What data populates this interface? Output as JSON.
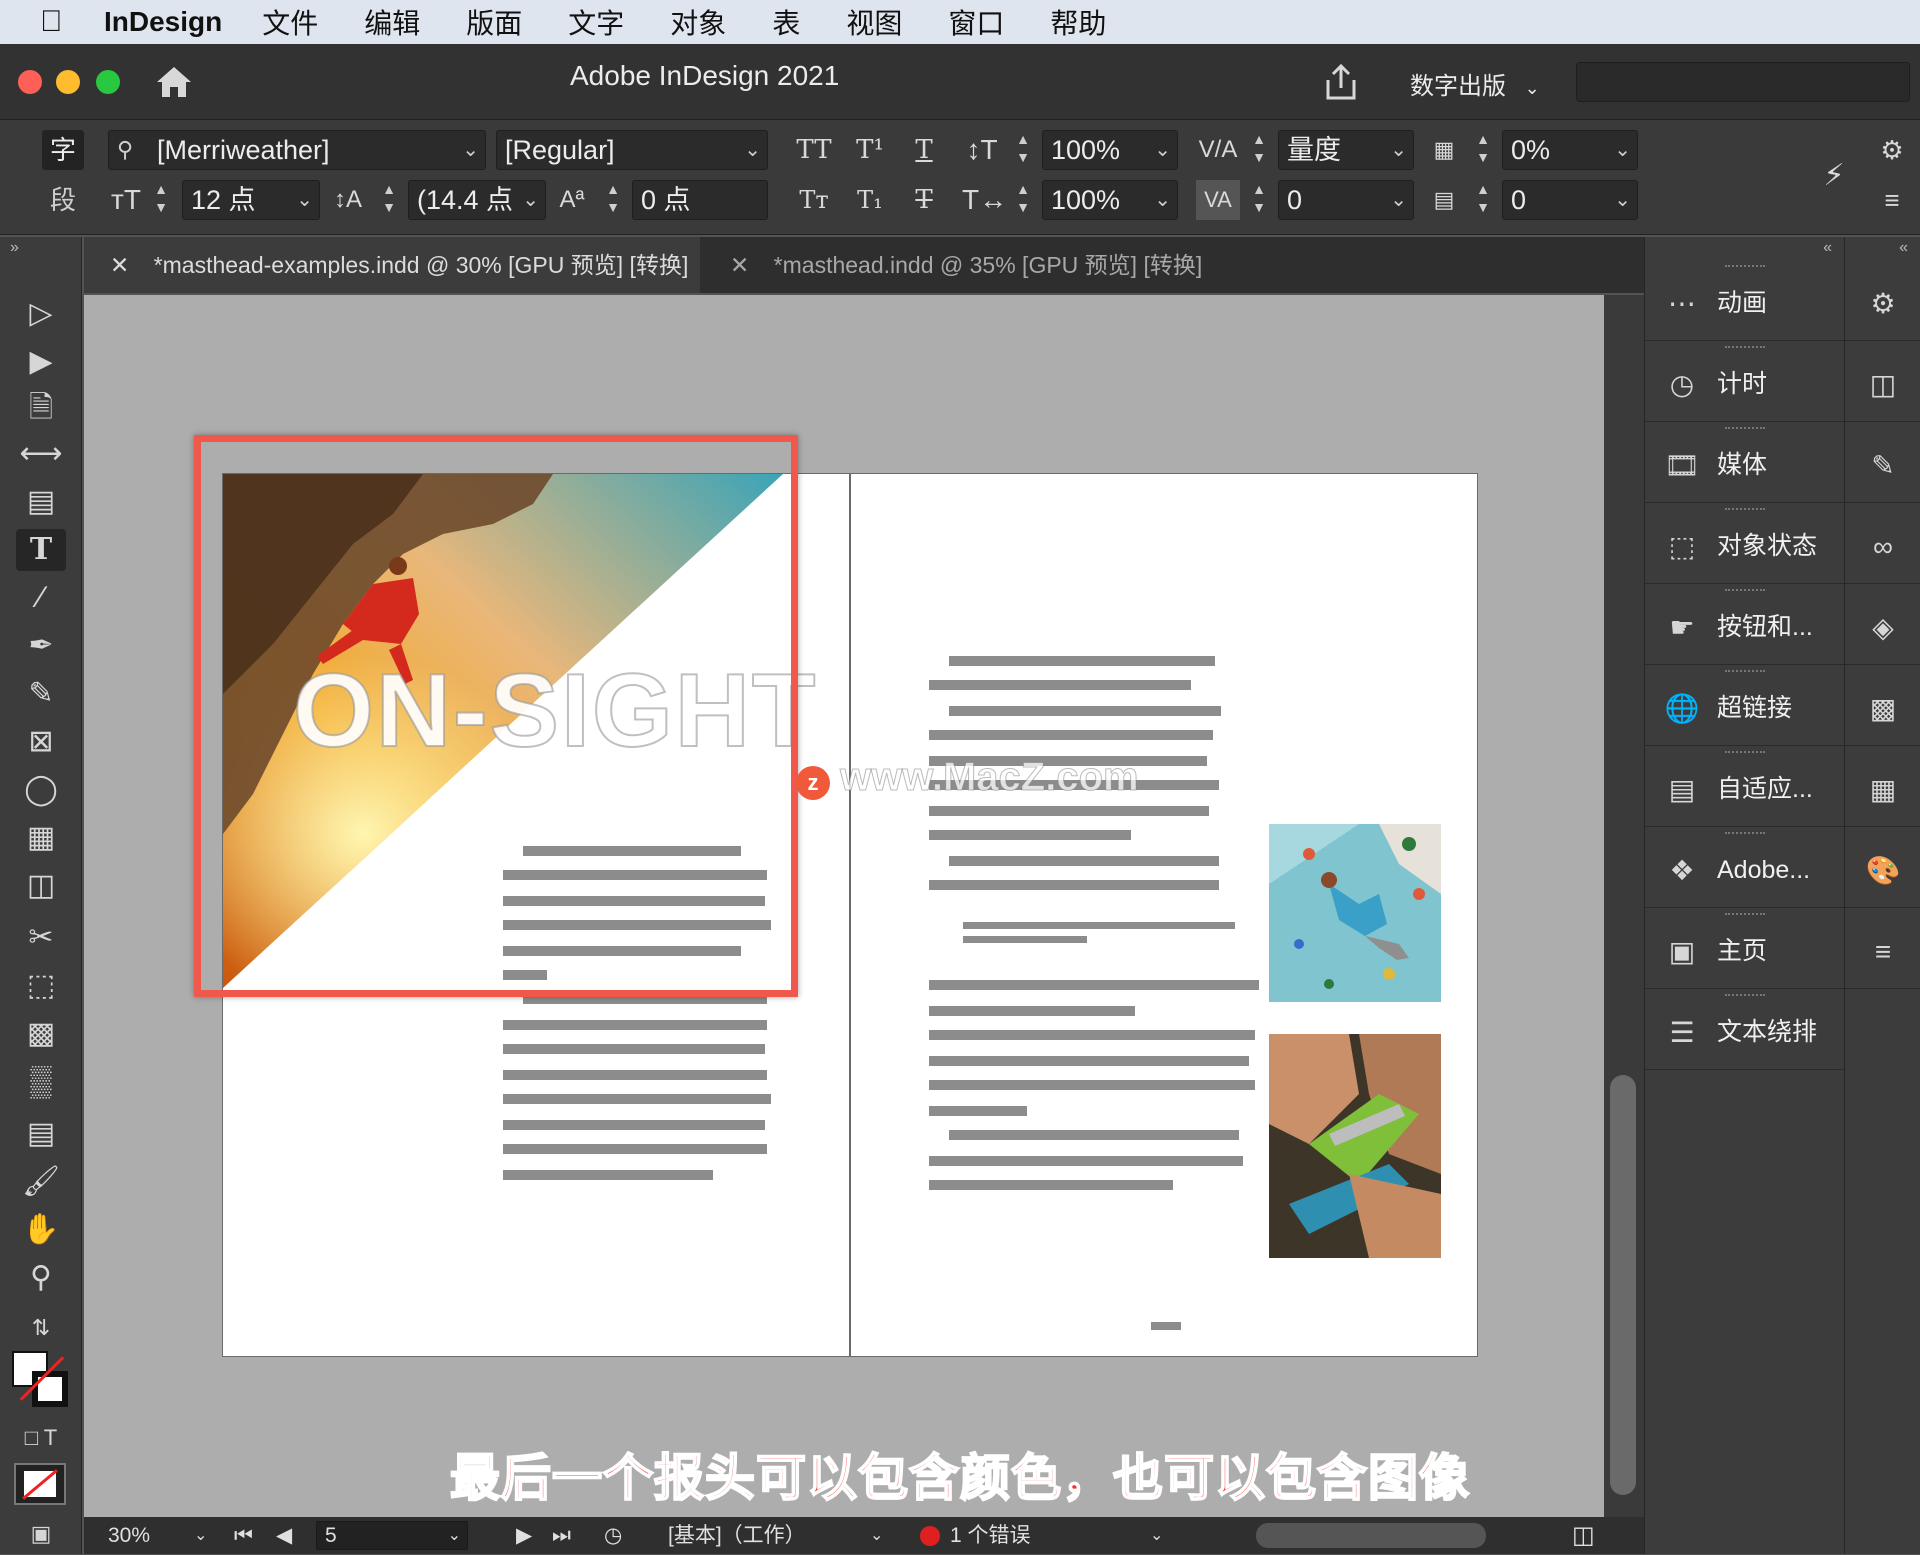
{
  "menubar": {
    "app_name": "InDesign",
    "items": [
      "文件",
      "编辑",
      "版面",
      "文字",
      "对象",
      "表",
      "视图",
      "窗口",
      "帮助"
    ]
  },
  "titlebar": {
    "title": "Adobe InDesign 2021",
    "workspace": "数字出版",
    "search_placeholder": ""
  },
  "control": {
    "char_label": "字",
    "para_label": "段",
    "font_family": "[Merriweather]",
    "font_style": "[Regular]",
    "font_size": "12 点",
    "leading": "(14.4 点",
    "baseline_shift": "0 点",
    "vertical_scale": "100%",
    "horizontal_scale": "100%",
    "kerning": "量度",
    "tracking": "0",
    "tsume": "0%",
    "grid_align": "0"
  },
  "tabs": [
    {
      "label": "*masthead-examples.indd @ 30% [GPU 预览] [转换]",
      "active": true
    },
    {
      "label": "*masthead.indd @ 35% [GPU 预览] [转换]",
      "active": false
    }
  ],
  "panels": [
    {
      "label": "动画",
      "icon": "animation-icon"
    },
    {
      "label": "计时",
      "icon": "timer-icon"
    },
    {
      "label": "媒体",
      "icon": "media-icon"
    },
    {
      "label": "对象状态",
      "icon": "object-states-icon"
    },
    {
      "label": "按钮和...",
      "icon": "buttons-icon"
    },
    {
      "label": "超链接",
      "icon": "hyperlinks-icon"
    },
    {
      "label": "自适应...",
      "icon": "liquid-layout-icon"
    },
    {
      "label": "Adobe...",
      "icon": "adobe-color-icon"
    },
    {
      "label": "主页",
      "icon": "pages-icon"
    },
    {
      "label": "文本绕排",
      "icon": "text-wrap-icon"
    }
  ],
  "document": {
    "masthead_text": "ON-SIGHT",
    "watermark": "www.MacZ.com"
  },
  "status": {
    "zoom": "30%",
    "page": "5",
    "profile": "[基本]（工作）",
    "errors": "1 个错误"
  },
  "caption": "最后一个报头可以包含颜色，也可以包含图像",
  "colors": {
    "highlight": "#f0584c",
    "caption": "#ff2d2d",
    "error_dot": "#e02020"
  }
}
